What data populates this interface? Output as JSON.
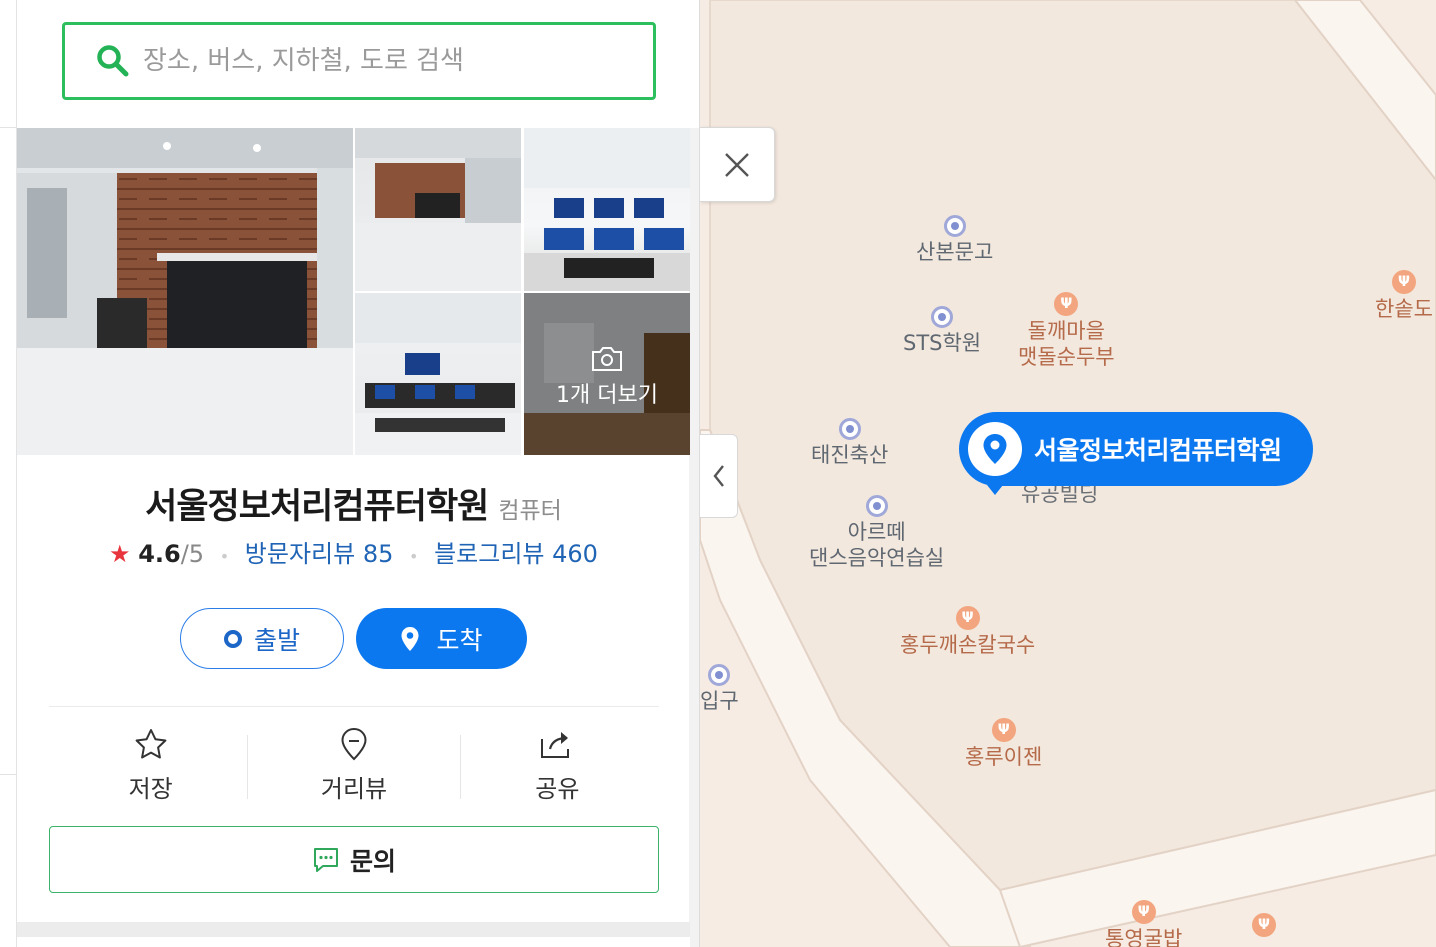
{
  "search": {
    "placeholder": "장소, 버스, 지하철, 도로 검색"
  },
  "place": {
    "name": "서울정보처리컴퓨터학원",
    "category": "컴퓨터",
    "rating": "4.6",
    "rating_max": "/5",
    "visitor_reviews": "방문자리뷰 85",
    "blog_reviews": "블로그리뷰 460"
  },
  "photos": {
    "more_label": "1개 더보기"
  },
  "route": {
    "depart_label": "출발",
    "arrive_label": "도착"
  },
  "actions": {
    "save_label": "저장",
    "streetview_label": "거리뷰",
    "share_label": "공유"
  },
  "inquiry": {
    "label": "문의"
  },
  "map": {
    "marker_label": "서울정보처리컴퓨터학원",
    "marker_sub": "유공빌딩",
    "pois": [
      {
        "name": "산본문고",
        "type": "place"
      },
      {
        "name": "STS학원",
        "type": "place"
      },
      {
        "name": "돌깨마을\n맷돌순두부",
        "type": "food"
      },
      {
        "name": "한솥도",
        "type": "food"
      },
      {
        "name": "태진축산",
        "type": "place"
      },
      {
        "name": "아르떼\n댄스음악연습실",
        "type": "place"
      },
      {
        "name": "홍두깨손칼국수",
        "type": "food"
      },
      {
        "name": "입구",
        "type": "place"
      },
      {
        "name": "홍루이젠",
        "type": "food"
      },
      {
        "name": "통영굴밥",
        "type": "food"
      }
    ]
  },
  "colors": {
    "accent": "#0c78f0",
    "search_border": "#2dbf5e",
    "link": "#2064b5",
    "star": "#e8343c"
  }
}
